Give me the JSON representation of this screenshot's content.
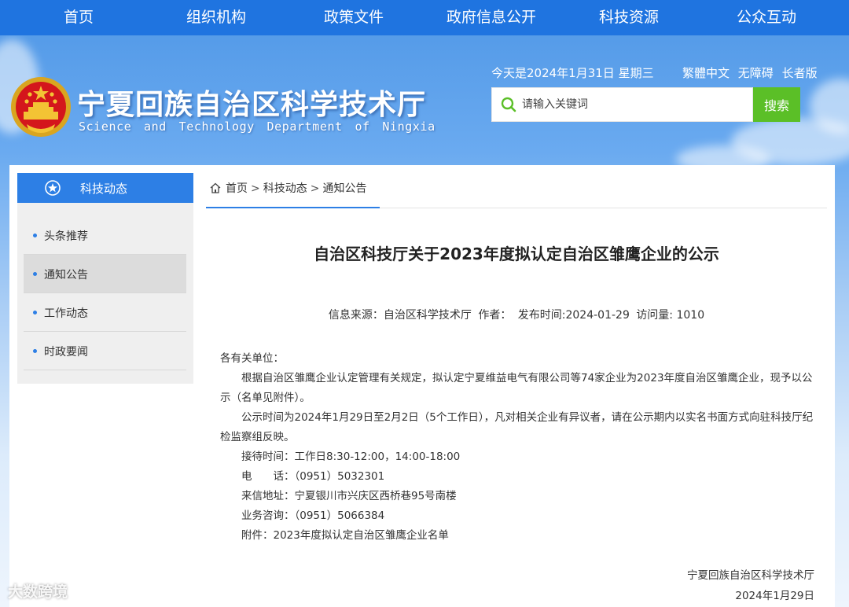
{
  "nav": {
    "items": [
      "首页",
      "组织机构",
      "政策文件",
      "政府信息公开",
      "科技资源",
      "公众互动"
    ]
  },
  "header": {
    "title": "宁夏回族自治区科学技术厅",
    "subtitle": "Science and Technology Department of Ningxia",
    "date_text": "今天是2024年1月31日 星期三",
    "links": [
      "繁體中文",
      "无障碍",
      "长者版"
    ],
    "search_placeholder": "请输入关键词",
    "search_button": "搜索",
    "emblem_icon": "national-emblem-icon"
  },
  "sidebar": {
    "title": "科技动态",
    "items": [
      {
        "label": "头条推荐",
        "active": false
      },
      {
        "label": "通知公告",
        "active": true
      },
      {
        "label": "工作动态",
        "active": false
      },
      {
        "label": "时政要闻",
        "active": false
      }
    ]
  },
  "breadcrumb": {
    "home": "首页",
    "sep": ">",
    "level1": "科技动态",
    "level2": "通知公告"
  },
  "article": {
    "title": "自治区科技厅关于2023年度拟认定自治区雏鹰企业的公示",
    "meta": {
      "source": "信息来源：自治区科学技术厅",
      "author": "作者：",
      "published": "发布时间:2024-01-29",
      "views": "访问量: 1010"
    },
    "greeting": "各有关单位：",
    "paragraphs": [
      "根据自治区雏鹰企业认定管理有关规定，拟认定宁夏维益电气有限公司等74家企业为2023年度自治区雏鹰企业，现予以公示（名单见附件）。",
      "公示时间为2024年1月29日至2月2日（5个工作日），凡对相关企业有异议者，请在公示期内以实名书面方式向驻科技厅纪检监察组反映。"
    ],
    "contacts": [
      "接待时间：工作日8:30-12:00，14:00-18:00",
      "电　　话：（0951）5032301",
      "来信地址：宁夏银川市兴庆区西桥巷95号南楼",
      "业务咨询：（0951）5066384"
    ],
    "attachment": "附件：2023年度拟认定自治区雏鹰企业名单",
    "signature_org": "宁夏回族自治区科学技术厅",
    "signature_date": "2024年1月29日"
  },
  "watermark": "大数跨境",
  "colors": {
    "nav_bg": "#1f74e0",
    "accent": "#2d7fe5",
    "search_button": "#5bbf27"
  }
}
